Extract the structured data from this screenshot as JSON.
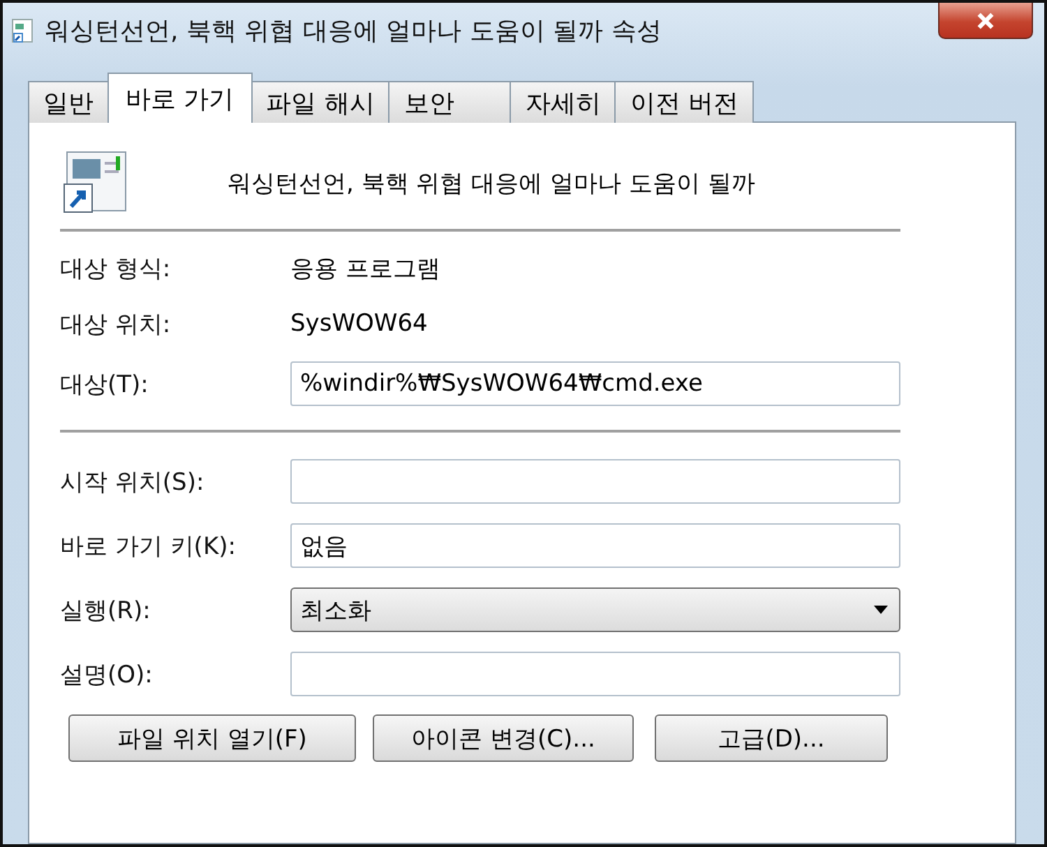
{
  "window": {
    "title": "워싱턴선언, 북핵 위협 대응에 얼마나 도움이 될까 속성"
  },
  "tabs": [
    {
      "label": "일반",
      "selected": false
    },
    {
      "label": "바로 가기",
      "selected": true
    },
    {
      "label": "파일 해시",
      "selected": false
    },
    {
      "label": "보안",
      "selected": false
    },
    {
      "label": "자세히",
      "selected": false
    },
    {
      "label": "이전 버전",
      "selected": false
    }
  ],
  "shortcut_name": "워싱턴선언, 북핵 위협 대응에 얼마나 도움이 될까",
  "info": [
    {
      "label": "대상 형식:",
      "value": "응용 프로그램"
    },
    {
      "label": "대상 위치:",
      "value": "SysWOW64"
    }
  ],
  "fields": [
    {
      "kind": "text",
      "label": "대상(T):",
      "value": "%windir%₩SysWOW64₩cmd.exe",
      "divider_after": true
    },
    {
      "kind": "text",
      "label": "시작 위치(S):"
    },
    {
      "kind": "text",
      "label": "바로 가기 키(K):",
      "value": "없음"
    },
    {
      "kind": "select",
      "label": "실행(R):",
      "value": "최소화"
    },
    {
      "kind": "text",
      "label": "설명(O):"
    }
  ],
  "buttons": [
    "파일 위치 열기(F)",
    "아이콘 변경(C)...",
    "고급(D)..."
  ]
}
